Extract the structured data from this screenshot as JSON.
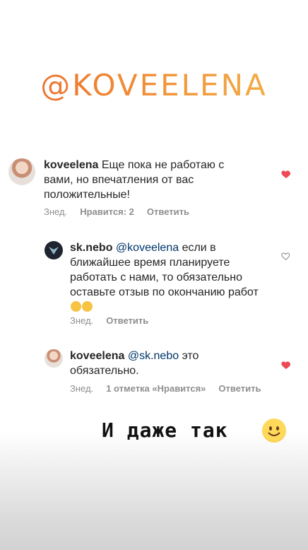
{
  "brand": "@KOVEELENA",
  "comments": [
    {
      "user": "koveelena",
      "text": "Еще пока не работаю с вами, но впечатления от вас положительные!",
      "meta": {
        "time": "Знед.",
        "likes": "Нравится: 2",
        "reply": "Ответить"
      },
      "liked": true
    },
    {
      "user": "sk.nebo",
      "mention": "@koveelena",
      "text": "если в ближайшее время планируете работать с нами, то обязательно оставьте отзыв по окончанию работ",
      "meta": {
        "time": "Знед.",
        "reply": "Ответить"
      },
      "liked": false
    },
    {
      "user": "koveelena",
      "mention": "@sk.nebo",
      "text": "это обязательно.",
      "meta": {
        "time": "Знед.",
        "likes": "1 отметка «Нравится»",
        "reply": "Ответить"
      },
      "liked": true
    }
  ],
  "footer": "И даже так",
  "colors": {
    "heart": "#ed4956",
    "mention": "#003569",
    "meta": "#8e8e8e"
  }
}
